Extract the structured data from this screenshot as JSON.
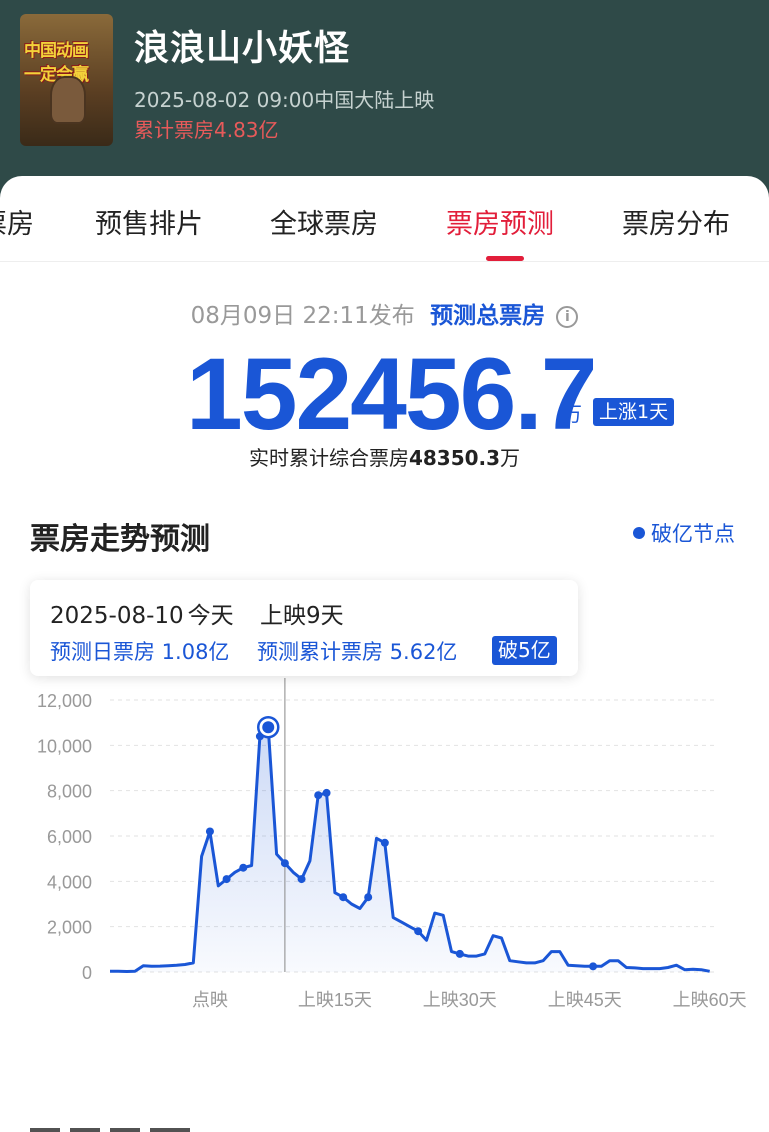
{
  "header": {
    "poster_line1": "中国动画",
    "poster_line2": "一定会赢",
    "title": "浪浪山小妖怪",
    "release": "2025-08-02 09:00中国大陆上映",
    "total_box_office": "累计票房4.83亿"
  },
  "tabs": [
    {
      "label": "票房"
    },
    {
      "label": "预售排片"
    },
    {
      "label": "全球票房"
    },
    {
      "label": "票房预测",
      "active": true
    },
    {
      "label": "票房分布"
    }
  ],
  "forecast": {
    "publish_time": "08月09日 22:11发布",
    "label": "预测总票房",
    "info_icon": "i",
    "value": "152456.7",
    "unit": "万",
    "badge": "上涨1天",
    "realtime_prefix": "实时累计综合票房",
    "realtime_value": "48350.3",
    "realtime_unit": "万"
  },
  "trend": {
    "title": "票房走势预测",
    "legend": "破亿节点"
  },
  "tooltip": {
    "date": "2025-08-10",
    "today": "今天",
    "day": "上映9天",
    "daily": "预测日票房 1.08亿",
    "total": "预测累计票房 5.62亿",
    "badge": "破5亿"
  },
  "colors": {
    "accent": "#1a56d6",
    "active_tab": "#e21e3a",
    "header_bg": "#2f4a48"
  },
  "chart_data": {
    "type": "area",
    "ylim": [
      0,
      12000
    ],
    "yticks": [
      "12,000",
      "10,000",
      "8,000",
      "6,000",
      "4,000",
      "2,000",
      "0"
    ],
    "ytick_values": [
      12000,
      10000,
      8000,
      6000,
      4000,
      2000,
      0
    ],
    "xticks": [
      {
        "label": "点映",
        "x": 8
      },
      {
        "label": "上映15天",
        "x": 23
      },
      {
        "label": "上映30天",
        "x": 38
      },
      {
        "label": "上映45天",
        "x": 53
      },
      {
        "label": "上映60天",
        "x": 68
      }
    ],
    "xlim": [
      -4,
      69
    ],
    "highlight_x": 17,
    "points": [
      {
        "x": -4,
        "y": 30
      },
      {
        "x": -3,
        "y": 30
      },
      {
        "x": -2,
        "y": 20
      },
      {
        "x": -1,
        "y": 30
      },
      {
        "x": 0,
        "y": 280
      },
      {
        "x": 1,
        "y": 250
      },
      {
        "x": 2,
        "y": 260
      },
      {
        "x": 3,
        "y": 280
      },
      {
        "x": 4,
        "y": 300
      },
      {
        "x": 5,
        "y": 330
      },
      {
        "x": 6,
        "y": 400
      },
      {
        "x": 7,
        "y": 5100
      },
      {
        "x": 8,
        "y": 6200
      },
      {
        "x": 9,
        "y": 3800
      },
      {
        "x": 10,
        "y": 4100
      },
      {
        "x": 11,
        "y": 4400
      },
      {
        "x": 12,
        "y": 4600
      },
      {
        "x": 13,
        "y": 4700
      },
      {
        "x": 14,
        "y": 10400
      },
      {
        "x": 15,
        "y": 10800
      },
      {
        "x": 16,
        "y": 5200
      },
      {
        "x": 17,
        "y": 4800
      },
      {
        "x": 18,
        "y": 4400
      },
      {
        "x": 19,
        "y": 4100
      },
      {
        "x": 20,
        "y": 4900
      },
      {
        "x": 21,
        "y": 7800
      },
      {
        "x": 22,
        "y": 7900
      },
      {
        "x": 23,
        "y": 3500
      },
      {
        "x": 24,
        "y": 3300
      },
      {
        "x": 25,
        "y": 3000
      },
      {
        "x": 26,
        "y": 2800
      },
      {
        "x": 27,
        "y": 3300
      },
      {
        "x": 28,
        "y": 5900
      },
      {
        "x": 29,
        "y": 5700
      },
      {
        "x": 30,
        "y": 2400
      },
      {
        "x": 31,
        "y": 2200
      },
      {
        "x": 32,
        "y": 2000
      },
      {
        "x": 33,
        "y": 1800
      },
      {
        "x": 34,
        "y": 1400
      },
      {
        "x": 35,
        "y": 2600
      },
      {
        "x": 36,
        "y": 2500
      },
      {
        "x": 37,
        "y": 900
      },
      {
        "x": 38,
        "y": 800
      },
      {
        "x": 39,
        "y": 700
      },
      {
        "x": 40,
        "y": 700
      },
      {
        "x": 41,
        "y": 800
      },
      {
        "x": 42,
        "y": 1600
      },
      {
        "x": 43,
        "y": 1500
      },
      {
        "x": 44,
        "y": 500
      },
      {
        "x": 45,
        "y": 450
      },
      {
        "x": 46,
        "y": 400
      },
      {
        "x": 47,
        "y": 400
      },
      {
        "x": 48,
        "y": 500
      },
      {
        "x": 49,
        "y": 900
      },
      {
        "x": 50,
        "y": 900
      },
      {
        "x": 51,
        "y": 300
      },
      {
        "x": 52,
        "y": 280
      },
      {
        "x": 53,
        "y": 250
      },
      {
        "x": 54,
        "y": 250
      },
      {
        "x": 55,
        "y": 250
      },
      {
        "x": 56,
        "y": 500
      },
      {
        "x": 57,
        "y": 500
      },
      {
        "x": 58,
        "y": 200
      },
      {
        "x": 59,
        "y": 180
      },
      {
        "x": 60,
        "y": 150
      },
      {
        "x": 61,
        "y": 150
      },
      {
        "x": 62,
        "y": 150
      },
      {
        "x": 63,
        "y": 200
      },
      {
        "x": 64,
        "y": 300
      },
      {
        "x": 65,
        "y": 100
      },
      {
        "x": 66,
        "y": 120
      },
      {
        "x": 67,
        "y": 100
      },
      {
        "x": 68,
        "y": 30
      }
    ],
    "markers": [
      8,
      10,
      12,
      14,
      17,
      19,
      21,
      22,
      24,
      27,
      29,
      33,
      38,
      54
    ],
    "series_color": "#1a56d6"
  }
}
